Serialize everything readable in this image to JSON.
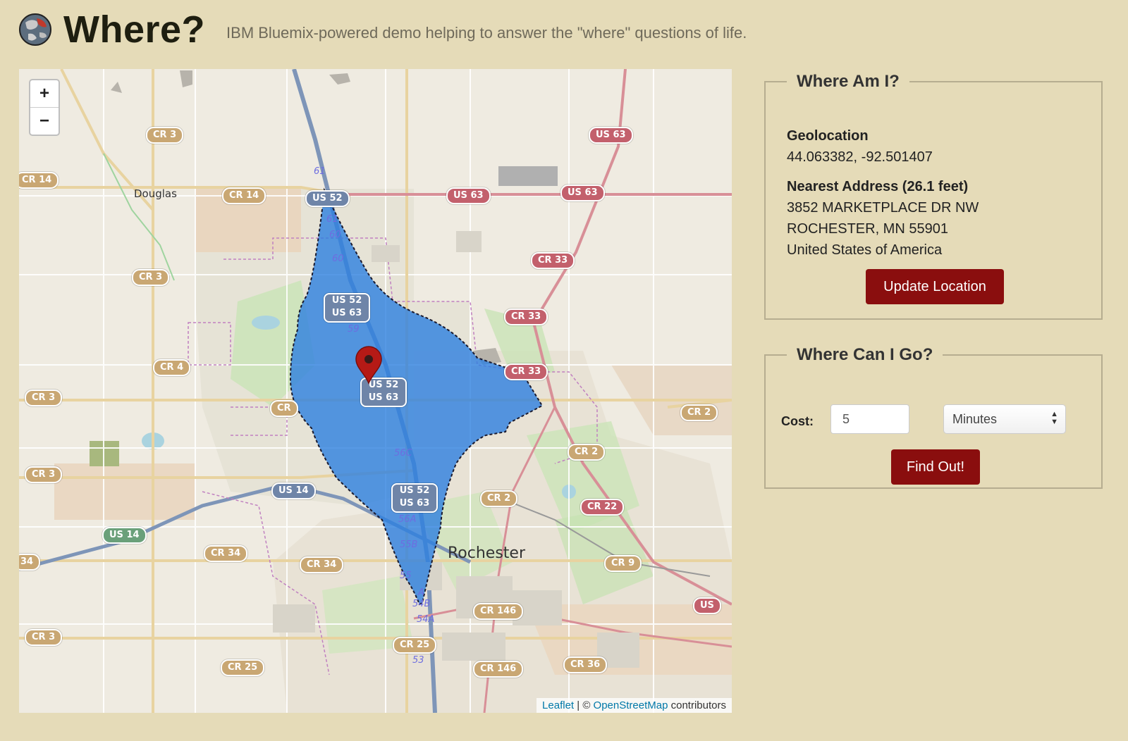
{
  "header": {
    "title": "Where?",
    "subtitle": "IBM Bluemix-powered demo helping to answer the \"where\" questions of life."
  },
  "map": {
    "zoom_in": "+",
    "zoom_out": "−",
    "attribution": {
      "leaflet": "Leaflet",
      "separator": " | © ",
      "osm": "OpenStreetMap",
      "suffix": " contributors"
    },
    "places": {
      "douglas": "Douglas",
      "rochester": "Rochester"
    },
    "shields": {
      "cr3a": "CR 3",
      "cr14a": "CR 14",
      "cr14b": "CR 14",
      "cr3b": "CR 3",
      "cr4": "CR 4",
      "cr3c": "CR 3",
      "cr3d": "CR 3",
      "cr3e": "CR 3",
      "us14a": "US 14",
      "us14b": "US 14",
      "cr34a": "CR 34",
      "cr34b": "CR 34",
      "cr25a": "CR 25",
      "cr25b": "CR 25",
      "cr146a": "CR 146",
      "cr146b": "CR 146",
      "cr36": "CR 36",
      "cr9": "CR 9",
      "cr22": "CR 22",
      "cr2a": "CR 2",
      "cr2b": "CR 2",
      "cr2c": "CR 2",
      "cr33a": "CR 33",
      "cr33b": "CR 33",
      "cr33c": "CR 33",
      "us63a": "US 63",
      "us63b": "US 63",
      "us63c": "US 63",
      "us52": "US 52",
      "us_edge": "US",
      "cr_partial": "CR",
      "cr34_partial": "34",
      "us5263a": "US 52 US 63",
      "us5263b": "US 52 US 63",
      "us5263c": "US 52 US 63"
    },
    "exits": {
      "e61": "61",
      "e61b": "61",
      "e60a": "60",
      "e60b": "60",
      "e59": "59",
      "e56c": "56C",
      "e56a": "56A",
      "e55b": "55B",
      "e55": "55",
      "e54a1": "A",
      "e54b": "54B",
      "e54a": "54A",
      "e53": "53"
    },
    "colors": {
      "isochrone": "#2d7fe0",
      "marker": "#b51a16"
    }
  },
  "where_am_i": {
    "legend": "Where Am I?",
    "geolocation_label": "Geolocation",
    "geolocation_value": "44.063382, -92.501407",
    "address_label": "Nearest Address (26.1 feet)",
    "address_line1": "3852 MARKETPLACE DR NW",
    "address_line2": "ROCHESTER, MN 55901",
    "address_line3": "United States of America",
    "button": "Update Location"
  },
  "where_can_i_go": {
    "legend": "Where Can I Go?",
    "cost_label": "Cost:",
    "cost_value": "5",
    "unit": "Minutes",
    "button": "Find Out!"
  }
}
